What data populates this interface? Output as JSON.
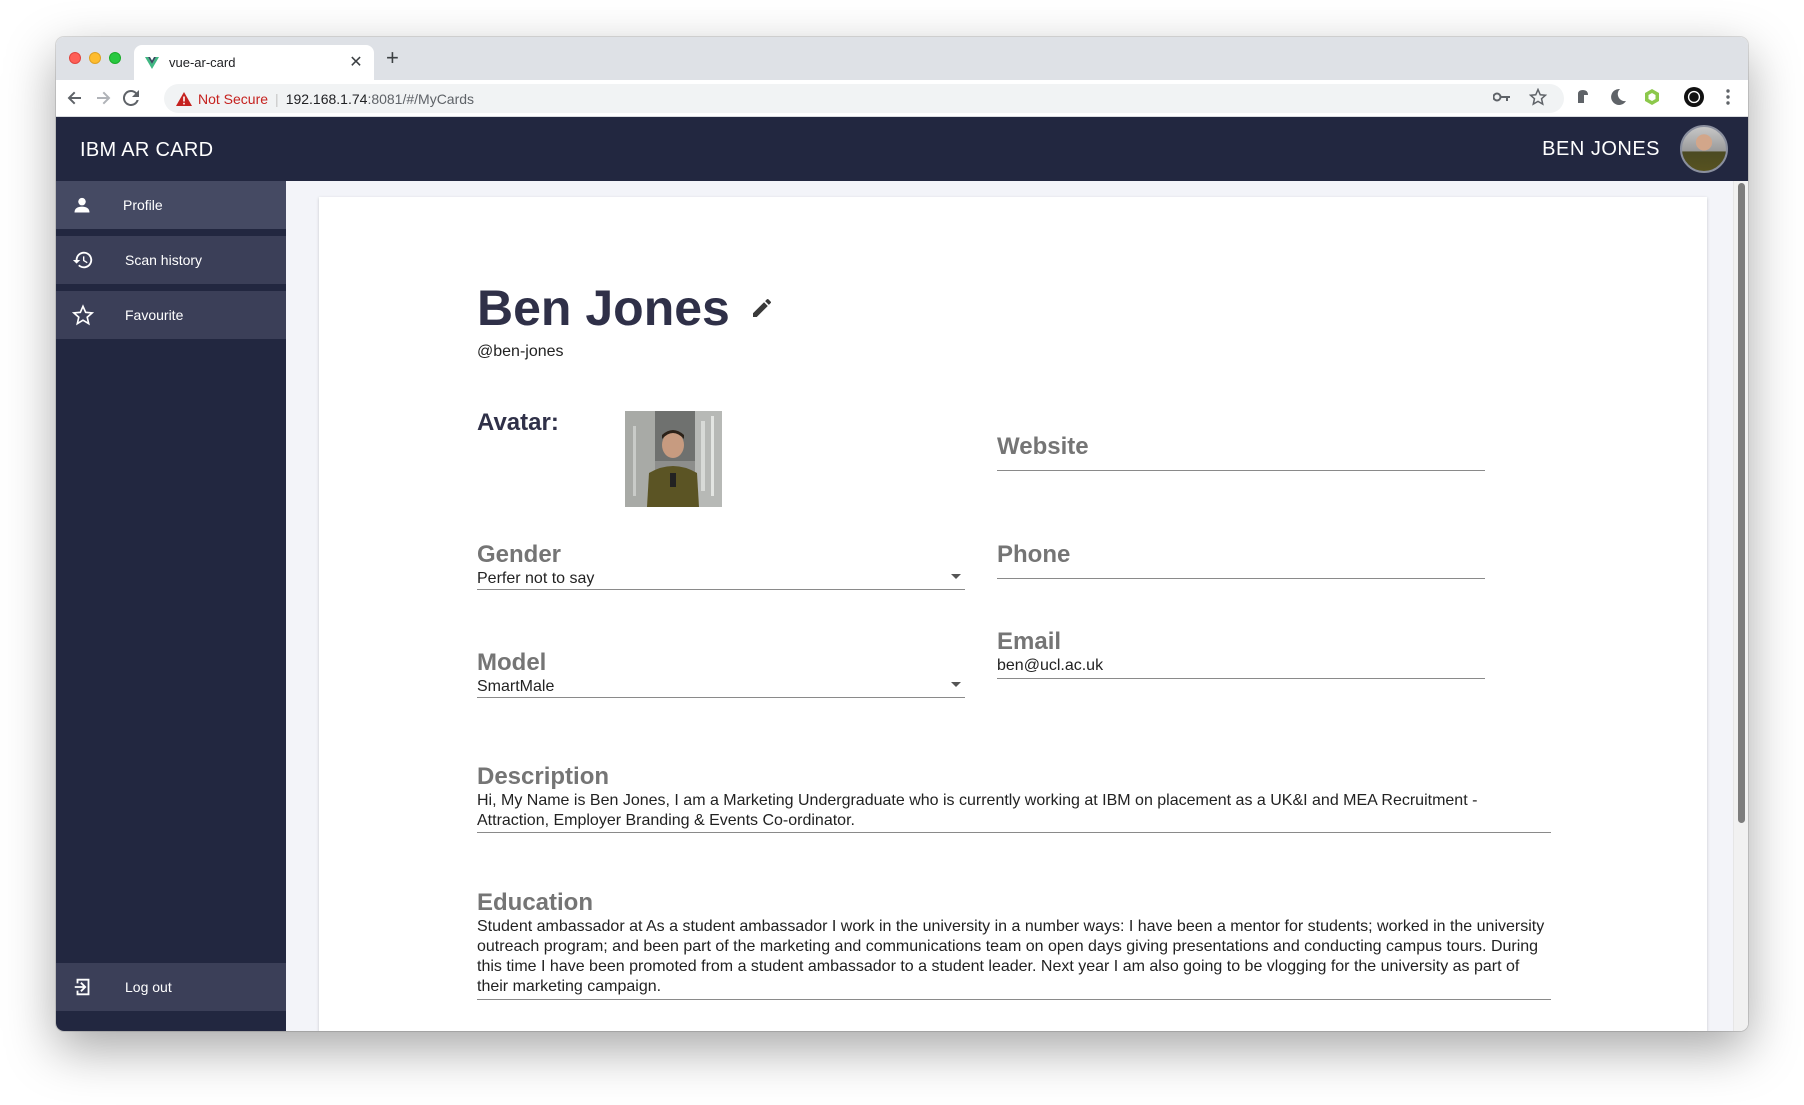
{
  "browser": {
    "tab_title": "vue-ar-card",
    "security_label": "Not Secure",
    "url_host": "192.168.1.74",
    "url_path": ":8081/#/MyCards"
  },
  "app": {
    "title": "IBM AR CARD",
    "user_name": "BEN JONES"
  },
  "sidebar": {
    "items": [
      {
        "label": "Profile",
        "icon": "person-icon"
      },
      {
        "label": "Scan history",
        "icon": "history-icon"
      },
      {
        "label": "Favourite",
        "icon": "star-icon"
      }
    ],
    "logout_label": "Log out"
  },
  "profile": {
    "name": "Ben Jones",
    "handle": "@ben-jones",
    "avatar_label": "Avatar:",
    "website": {
      "label": "Website",
      "value": ""
    },
    "gender": {
      "label": "Gender",
      "value": "Perfer not to say"
    },
    "phone": {
      "label": "Phone",
      "value": ""
    },
    "model": {
      "label": "Model",
      "value": "SmartMale"
    },
    "email": {
      "label": "Email",
      "value": "ben@ucl.ac.uk"
    },
    "description": {
      "label": "Description",
      "value": "Hi, My Name is Ben Jones, I am a Marketing Undergraduate who is currently working at IBM on placement as a UK&I and MEA Recruitment - Attraction, Employer Branding & Events Co-ordinator."
    },
    "education": {
      "label": "Education",
      "value": "Student ambassador at As a student ambassador I work in the university in a number ways: I have been a mentor for students; worked in the university outreach program; and been part of the marketing and communications team on open days giving presentations and conducting campus tours. During this time I have been promoted from a student ambassador to a student leader. Next year I am also going to be vlogging for the university as part of their marketing campaign."
    }
  },
  "colors": {
    "appbar": "#222740",
    "sidebar_item": "#3b3f58",
    "heading": "#2f3048",
    "content_bg": "#f3f4f9"
  }
}
